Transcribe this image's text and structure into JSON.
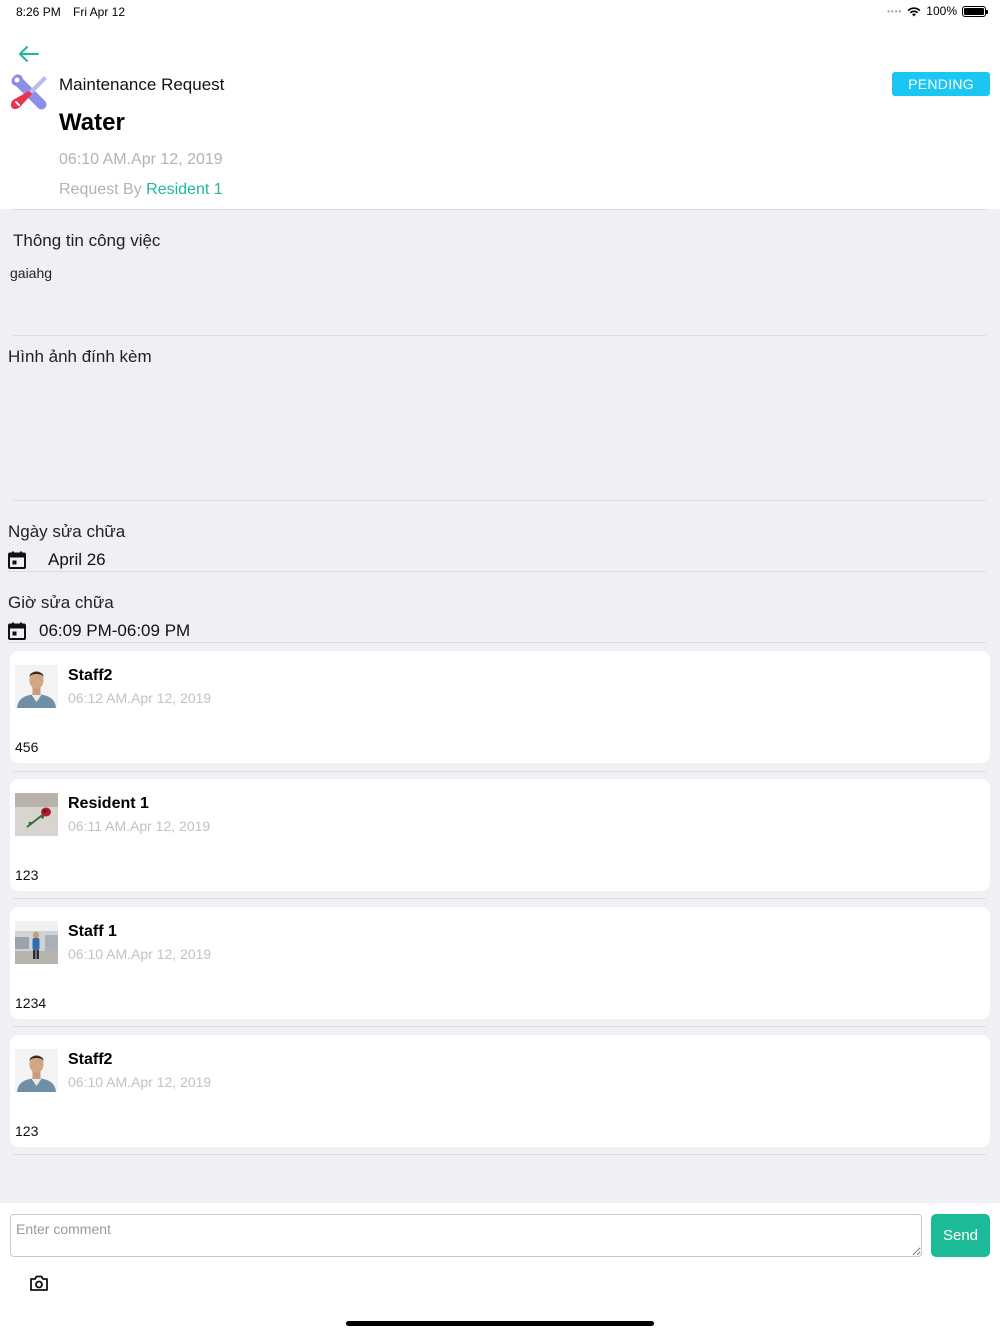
{
  "status_bar": {
    "time": "8:26 PM",
    "date": "Fri Apr 12",
    "battery": "100%",
    "battery_level": 1.0
  },
  "header": {
    "back_icon": "arrow-left-icon",
    "app_icon": "tools-icon",
    "request_type": "Maintenance Request",
    "title": "Water",
    "datetime": "06:10 AM.Apr 12, 2019",
    "request_by_label": "Request By",
    "request_by_name": "Resident 1",
    "status": "PENDING",
    "accent_color": "#1db89a",
    "status_color": "#1cc6f3"
  },
  "job_info": {
    "title": "Thông tin công việc",
    "text": "gaiahg"
  },
  "attachments": {
    "title": "Hình ảnh đính kèm"
  },
  "repair_date": {
    "title": "Ngày sửa chữa",
    "value": "April 26",
    "icon": "calendar-icon"
  },
  "repair_time": {
    "title": "Giờ sửa chữa",
    "value": "06:09 PM-06:09 PM",
    "icon": "calendar-icon"
  },
  "comments": [
    {
      "name": "Staff2",
      "datetime": "06:12 AM.Apr 12, 2019",
      "body": "456",
      "avatar": "staff-man-photo"
    },
    {
      "name": "Resident 1",
      "datetime": "06:11 AM.Apr 12, 2019",
      "body": "123",
      "avatar": "rose-photo"
    },
    {
      "name": "Staff 1",
      "datetime": "06:10 AM.Apr 12, 2019",
      "body": "1234",
      "avatar": "office-person-photo"
    },
    {
      "name": "Staff2",
      "datetime": "06:10 AM.Apr 12, 2019",
      "body": "123",
      "avatar": "staff-man-photo"
    }
  ],
  "composer": {
    "placeholder": "Enter comment",
    "send_label": "Send",
    "camera_icon": "camera-icon"
  }
}
